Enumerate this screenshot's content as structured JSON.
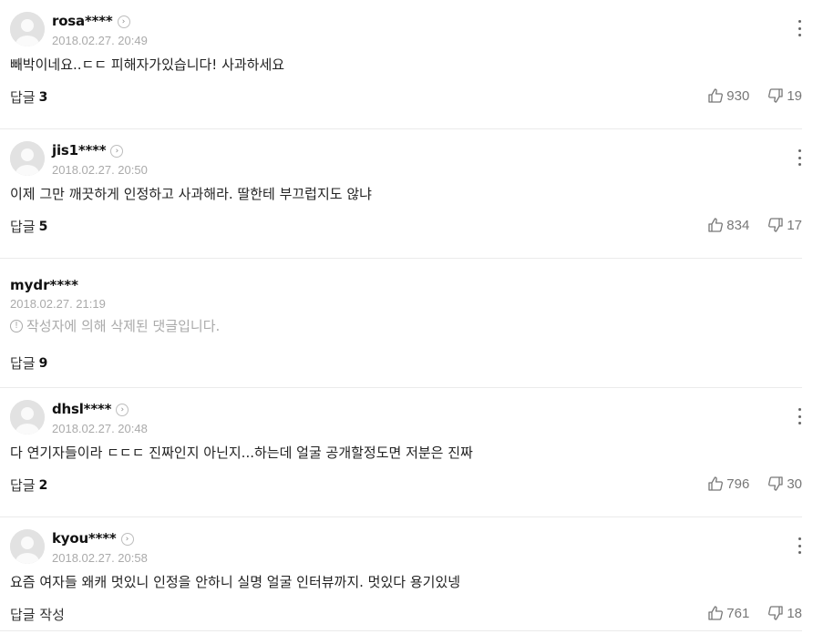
{
  "comments": [
    {
      "author": "rosa****",
      "date": "2018.02.27. 20:49",
      "text": "빼박이네요..ㄷㄷ 피해자가있습니다! 사과하세요",
      "reply_label": "답글",
      "reply_count": "3",
      "likes": "930",
      "dislikes": "19"
    },
    {
      "author": "jis1****",
      "date": "2018.02.27. 20:50",
      "text": "이제 그만 깨끗하게 인정하고 사과해라. 딸한테 부끄럽지도 않냐",
      "reply_label": "답글",
      "reply_count": "5",
      "likes": "834",
      "dislikes": "17"
    },
    {
      "author": "mydr****",
      "date": "2018.02.27. 21:19",
      "deleted_notice": "작성자에 의해 삭제된 댓글입니다.",
      "reply_label": "답글",
      "reply_count": "9"
    },
    {
      "author": "dhsl****",
      "date": "2018.02.27. 20:48",
      "text": "다 연기자들이라 ㄷㄷㄷ 진짜인지 아닌지...하는데 얼굴 공개할정도면 저분은 진짜",
      "reply_label": "답글",
      "reply_count": "2",
      "likes": "796",
      "dislikes": "30"
    },
    {
      "author": "kyou****",
      "date": "2018.02.27. 20:58",
      "text": "요즘 여자들 왜캐 멋있니 인정을 안하니 실명 얼굴 인터뷰까지. 멋있다 용기있넹",
      "reply_label": "답글 작성",
      "likes": "761",
      "dislikes": "18"
    }
  ],
  "icons": {
    "profile_more": "chevron-right-circle-icon",
    "kebab": "kebab-menu-icon",
    "like": "thumbs-up-icon",
    "dislike": "thumbs-down-icon",
    "notice": "exclamation-circle-icon"
  }
}
